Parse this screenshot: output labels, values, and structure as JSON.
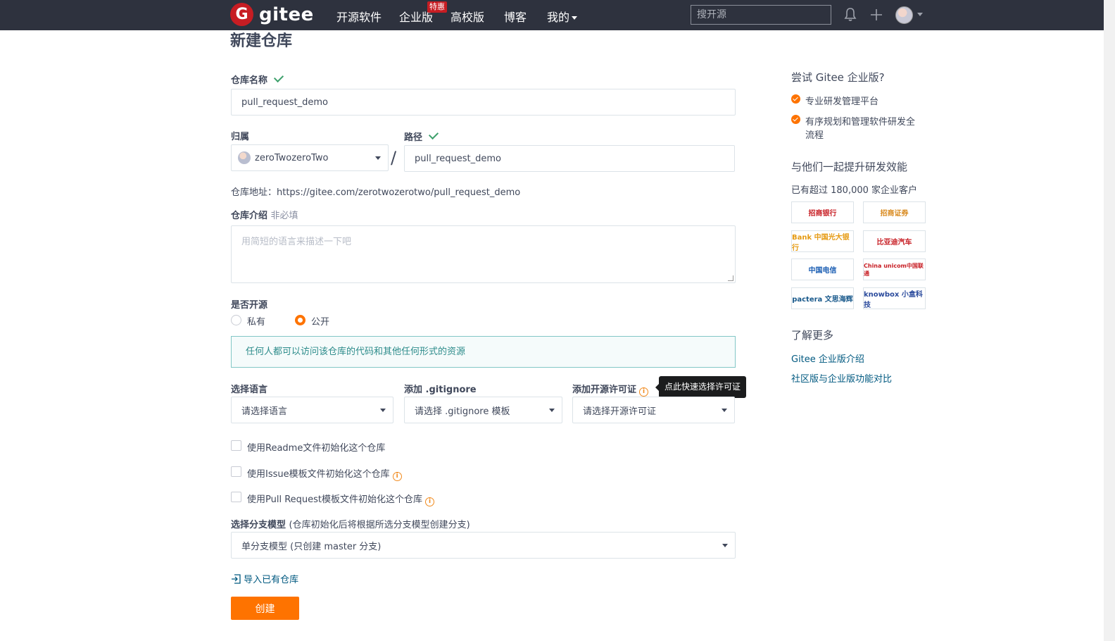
{
  "nav": {
    "logo_text": "gitee",
    "items": [
      "开源软件",
      "企业版",
      "高校版",
      "博客",
      "我的"
    ],
    "hot_badge": "特惠",
    "search_placeholder": "搜开源"
  },
  "page": {
    "title": "新建仓库"
  },
  "form": {
    "repo_name_label": "仓库名称",
    "repo_name_value": "pull_request_demo",
    "owner_label": "归属",
    "owner_value": "zeroTwozeroTwo",
    "path_label": "路径",
    "path_value": "pull_request_demo",
    "repo_url": "仓库地址：https://gitee.com/zerotwozerotwo/pull_request_demo",
    "desc_label": "仓库介绍",
    "desc_optional": "非必填",
    "desc_placeholder": "用简短的语言来描述一下吧",
    "visibility_label": "是否开源",
    "visibility_options": [
      "私有",
      "公开"
    ],
    "visibility_selected": "公开",
    "visibility_notice": "任何人都可以访问该仓库的代码和其他任何形式的资源",
    "language_label": "选择语言",
    "language_value": "请选择语言",
    "gitignore_label": "添加 .gitignore",
    "gitignore_value": "请选择 .gitignore 模板",
    "license_label": "添加开源许可证",
    "license_value": "请选择开源许可证",
    "license_tooltip": "点此快速选择许可证",
    "init_readme": "使用Readme文件初始化这个仓库",
    "init_issue": "使用Issue模板文件初始化这个仓库",
    "init_pr": "使用Pull Request模板文件初始化这个仓库",
    "branch_label": "选择分支模型",
    "branch_hint": "(仓库初始化后将根据所选分支模型创建分支)",
    "branch_value": "单分支模型 (只创建 master 分支)",
    "import_link": "导入已有仓库",
    "create_button": "创建"
  },
  "sidebar": {
    "try_title": "尝试 Gitee 企业版?",
    "features": [
      "专业研发管理平台",
      "有序规划和管理软件研发全",
      "流程"
    ],
    "together_title": "与他们一起提升研发效能",
    "customers": "已有超过 180,000 家企业客户",
    "logos": [
      "招商银行",
      "招商证券",
      "Bank 中国光大银行",
      "比亚迪汽车",
      "中国电信",
      "China unicom中国联通",
      "pactera 文思海辉",
      "knowbox 小盒科技"
    ],
    "more_title": "了解更多",
    "links": [
      "Gitee 企业版介绍",
      "社区版与企业版功能对比"
    ]
  },
  "colors": {
    "brand": "#c71d23",
    "accent": "#fe7300",
    "nav_bg": "#2e323e",
    "link": "#005980"
  }
}
